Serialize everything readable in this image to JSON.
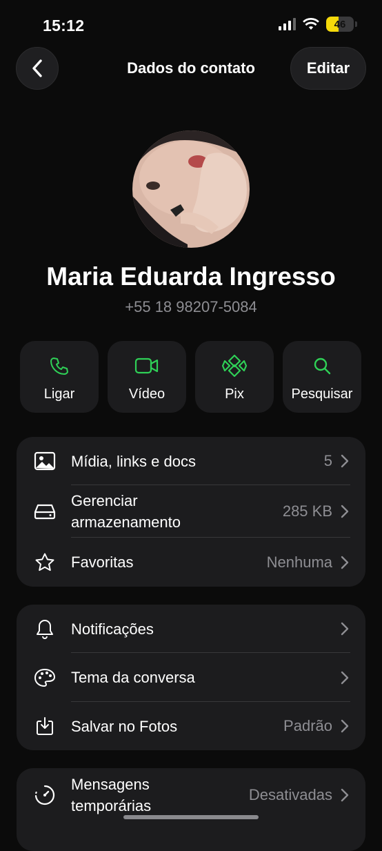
{
  "status_bar": {
    "time": "15:12",
    "battery_level": "46",
    "battery_fraction": 0.46
  },
  "nav": {
    "title": "Dados do contato",
    "edit_label": "Editar",
    "back_icon": "chevron-left-icon"
  },
  "contact": {
    "name": "Maria Eduarda Ingresso",
    "phone": "+55 18 98207-5084"
  },
  "colors": {
    "accent": "#2fd157",
    "card": "#1c1c1e",
    "secondary_text": "#8e8e93",
    "battery": "#f5d90a"
  },
  "actions": [
    {
      "label": "Ligar",
      "icon": "phone-icon"
    },
    {
      "label": "Vídeo",
      "icon": "video-camera-icon"
    },
    {
      "label": "Pix",
      "icon": "pix-icon"
    },
    {
      "label": "Pesquisar",
      "icon": "search-icon"
    }
  ],
  "group1": [
    {
      "label": "Mídia, links e docs",
      "value": "5",
      "icon": "image-icon"
    },
    {
      "label": "Gerenciar armazenamento",
      "value": "285 KB",
      "icon": "storage-icon"
    },
    {
      "label": "Favoritas",
      "value": "Nenhuma",
      "icon": "star-icon"
    }
  ],
  "group2": [
    {
      "label": "Notificações",
      "value": "",
      "icon": "bell-icon"
    },
    {
      "label": "Tema da conversa",
      "value": "",
      "icon": "palette-icon"
    },
    {
      "label": "Salvar no Fotos",
      "value": "Padrão",
      "icon": "save-download-icon"
    }
  ],
  "group3": [
    {
      "label": "Mensagens temporárias",
      "value": "Desativadas",
      "icon": "timer-icon"
    }
  ]
}
